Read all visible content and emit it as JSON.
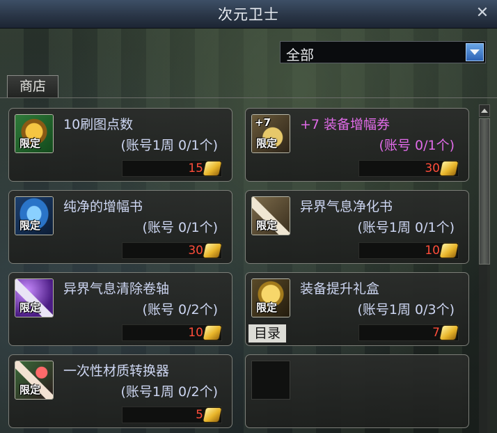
{
  "window": {
    "title": "次元卫士",
    "close_symbol": "✕"
  },
  "filter": {
    "selected": "全部"
  },
  "tabs": {
    "shop": "商店"
  },
  "catalog_button": "目录",
  "items": [
    {
      "name": "10刷图点数",
      "limit": "(账号1周 0/1个)",
      "price": "15",
      "badge": "限定",
      "icon": "potion-icon",
      "color": "#cdd6f2"
    },
    {
      "name": "+7 装备增幅券",
      "limit": "(账号 0/1个)",
      "price": "30",
      "badge": "限定",
      "icon": "amplify-ticket-icon",
      "plus_text": "+7",
      "color": "#e06be8"
    },
    {
      "name": "纯净的增幅书",
      "limit": "(账号 0/1个)",
      "price": "30",
      "badge": "限定",
      "icon": "blue-book-icon",
      "color": "#cdd6f2"
    },
    {
      "name": "异界气息净化书",
      "limit": "(账号1周 0/1个)",
      "price": "10",
      "badge": "限定",
      "icon": "scroll-icon",
      "color": "#cdd6f2"
    },
    {
      "name": "异界气息清除卷轴",
      "limit": "(账号 0/2个)",
      "price": "10",
      "badge": "限定",
      "icon": "purple-scroll-icon",
      "color": "#cdd6f2"
    },
    {
      "name": "装备提升礼盒",
      "limit": "(账号1周 0/3个)",
      "price": "7",
      "badge": "限定",
      "icon": "gift-box-icon",
      "color": "#cdd6f2"
    },
    {
      "name": "一次性材质转换器",
      "limit": "(账号1周 0/2个)",
      "price": "5",
      "badge": "限定",
      "icon": "converter-icon",
      "color": "#cdd6f2"
    }
  ]
}
